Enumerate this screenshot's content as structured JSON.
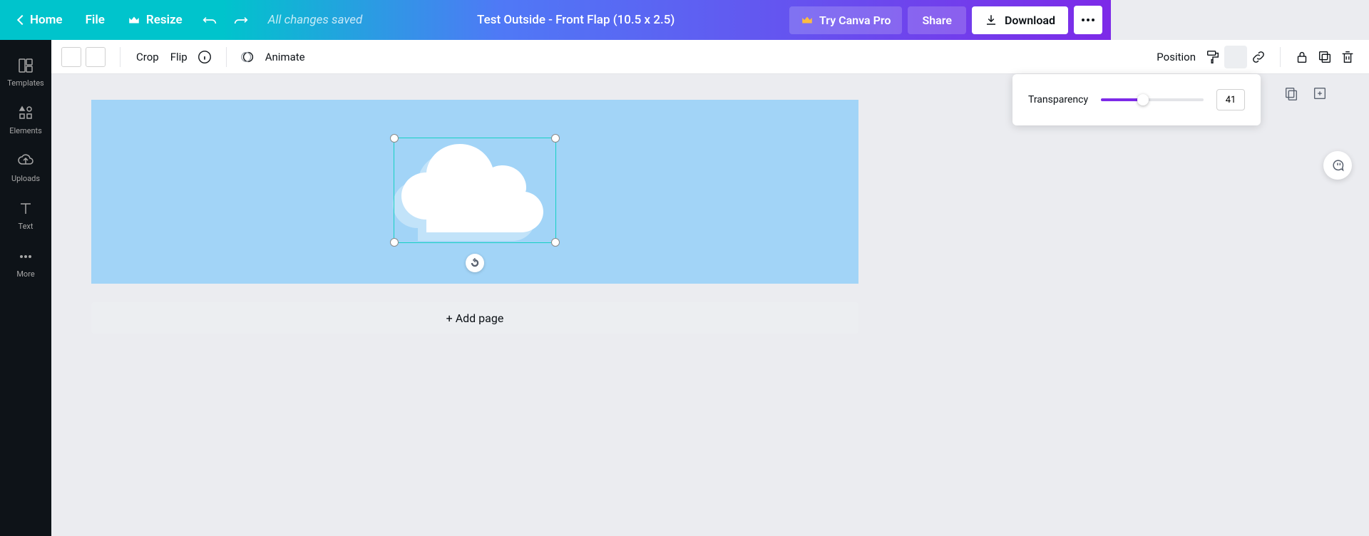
{
  "header": {
    "home": "Home",
    "file": "File",
    "resize": "Resize",
    "saved": "All changes saved",
    "title": "Test Outside - Front Flap (10.5 x 2.5)",
    "try_pro": "Try Canva Pro",
    "share": "Share",
    "download": "Download"
  },
  "sidebar": {
    "templates": "Templates",
    "elements": "Elements",
    "uploads": "Uploads",
    "text": "Text",
    "more": "More"
  },
  "toolbar": {
    "crop": "Crop",
    "flip": "Flip",
    "animate": "Animate",
    "position": "Position"
  },
  "transparency": {
    "label": "Transparency",
    "value": "41",
    "percent": 41
  },
  "canvas": {
    "add_page": "+ Add page",
    "bg_color": "#a2d4f7"
  }
}
